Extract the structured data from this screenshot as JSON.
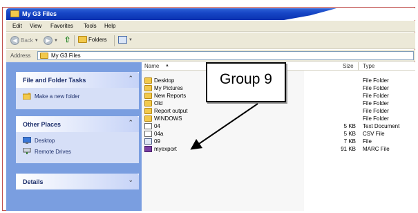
{
  "window": {
    "title": "My G3 Files"
  },
  "menu": [
    "Edit",
    "View",
    "Favorites",
    "Tools",
    "Help"
  ],
  "toolbar": {
    "back_label": "Back",
    "folders_label": "Folders"
  },
  "address": {
    "label": "Address",
    "value": "My G3 Files"
  },
  "task_pane": {
    "file_folder_tasks": {
      "title": "File and Folder Tasks",
      "items": [
        "Make a new folder"
      ]
    },
    "other_places": {
      "title": "Other Places",
      "items": [
        "Desktop",
        "Remote Drives"
      ]
    },
    "details": {
      "title": "Details"
    }
  },
  "columns": {
    "name": "Name",
    "size": "Size",
    "type": "Type"
  },
  "files": [
    {
      "name": "Desktop",
      "size": "",
      "type": "File Folder",
      "icon": "folder-icon"
    },
    {
      "name": "My Pictures",
      "size": "",
      "type": "File Folder",
      "icon": "folder-icon"
    },
    {
      "name": "New Reports",
      "size": "",
      "type": "File Folder",
      "icon": "folder-icon"
    },
    {
      "name": "Old",
      "size": "",
      "type": "File Folder",
      "icon": "folder-icon"
    },
    {
      "name": "Report output",
      "size": "",
      "type": "File Folder",
      "icon": "folder-icon"
    },
    {
      "name": "WINDOWS",
      "size": "",
      "type": "File Folder",
      "icon": "folder-icon"
    },
    {
      "name": "04",
      "size": "5 KB",
      "type": "Text Document",
      "icon": "text-document-icon"
    },
    {
      "name": "04a",
      "size": "5 KB",
      "type": "CSV File",
      "icon": "text-document-icon"
    },
    {
      "name": "09",
      "size": "7 KB",
      "type": "File",
      "icon": "file-icon"
    },
    {
      "name": "myexport",
      "size": "91 KB",
      "type": "MARC File",
      "icon": "marc-file-icon"
    }
  ],
  "callout": {
    "text": "Group 9"
  },
  "colors": {
    "titlebar": "#0a32b0",
    "taskpane": "#7a9ee0",
    "frame": "#c0504d"
  }
}
